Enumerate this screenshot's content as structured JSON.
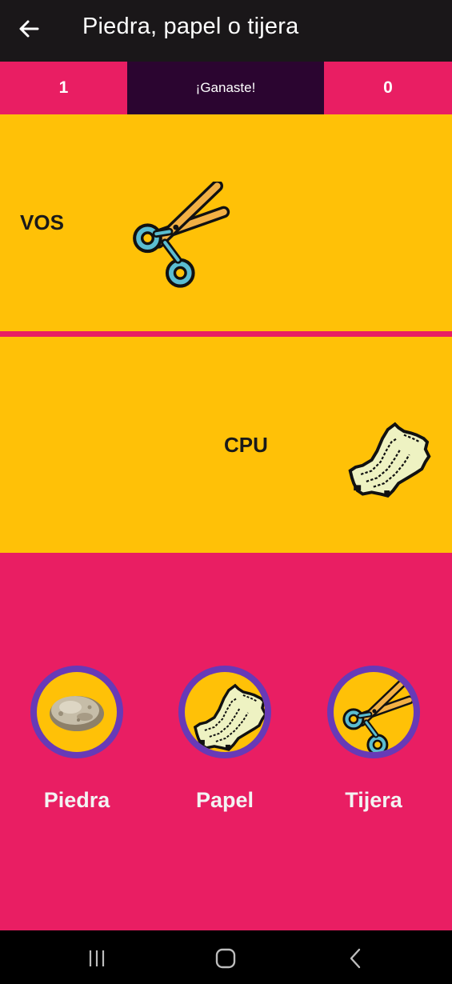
{
  "app": {
    "title": "Piedra, papel o tijera",
    "back_icon": "arrow-left-icon"
  },
  "scoreboard": {
    "player_score": "1",
    "result": "¡Ganaste!",
    "cpu_score": "0"
  },
  "player_panel": {
    "label": "VOS",
    "choice_icon": "scissors-icon"
  },
  "cpu_panel": {
    "label": "CPU",
    "choice_icon": "paper-icon"
  },
  "choices": [
    {
      "label": "Piedra",
      "icon": "rock-icon"
    },
    {
      "label": "Papel",
      "icon": "paper-icon"
    },
    {
      "label": "Tijera",
      "icon": "scissors-icon"
    }
  ],
  "system_nav": {
    "recents_icon": "recents-icon",
    "home_icon": "home-icon",
    "back_icon": "chevron-left-icon"
  },
  "colors": {
    "app_bar": "#1a1719",
    "accent_pink": "#e91e63",
    "panel_amber": "#ffc107",
    "result_dark": "#2b0530",
    "choice_ring": "#673ab7"
  }
}
